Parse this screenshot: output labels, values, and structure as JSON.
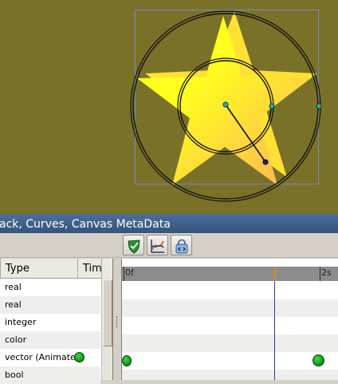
{
  "panel": {
    "title": "ack, Curves, Canvas MetaData"
  },
  "toolbar": {
    "buttons": [
      {
        "name": "params-panel-button",
        "icon": "shield-check-icon"
      },
      {
        "name": "curves-panel-button",
        "icon": "curves-icon"
      },
      {
        "name": "metadata-panel-button",
        "icon": "lock-icon"
      }
    ]
  },
  "params": {
    "columns": {
      "type": "Type",
      "time": "Tim"
    },
    "rows": [
      {
        "type": "real",
        "waypoint": false
      },
      {
        "type": "real",
        "waypoint": false
      },
      {
        "type": "integer",
        "waypoint": false
      },
      {
        "type": "color",
        "waypoint": false
      },
      {
        "type": "vector (Animated)",
        "waypoint": true
      },
      {
        "type": "bool",
        "waypoint": false
      }
    ]
  },
  "timetrack": {
    "start_label": "0f",
    "end_label": "2s"
  },
  "colors": {
    "canvas_bg": "#7a7128",
    "star_fill_a": "#ffff1e",
    "star_fill_b": "#ffb05a",
    "waypoint": "#13a81c",
    "time_cursor": "#2b3fa0"
  }
}
